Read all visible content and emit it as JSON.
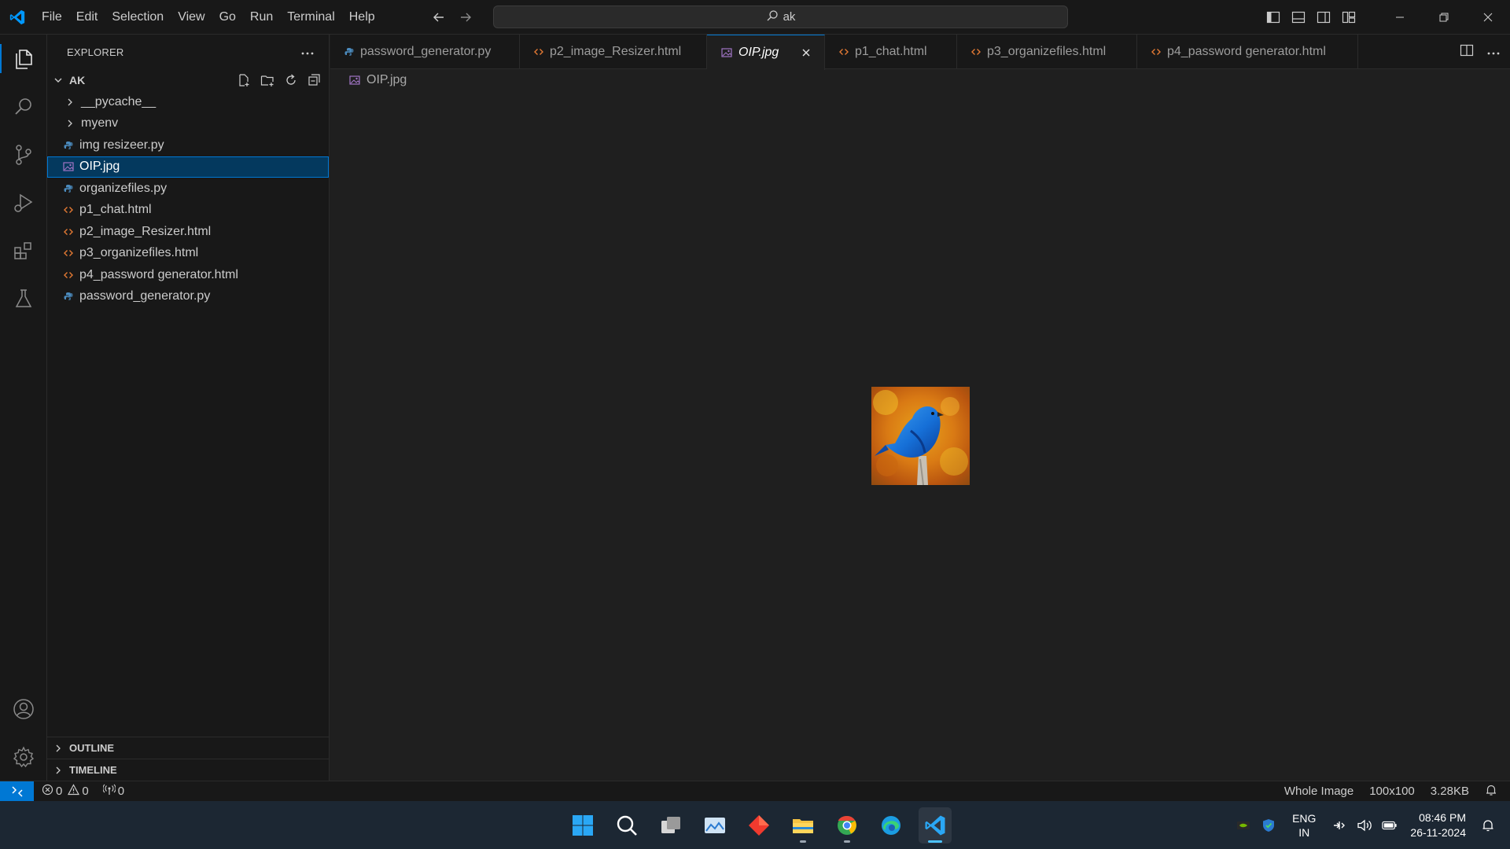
{
  "menu": [
    "File",
    "Edit",
    "Selection",
    "View",
    "Go",
    "Run",
    "Terminal",
    "Help"
  ],
  "search": {
    "text": "ak"
  },
  "sidebar": {
    "title": "EXPLORER",
    "folder": "AK",
    "items": [
      {
        "label": "__pycache__",
        "kind": "folder"
      },
      {
        "label": "myenv",
        "kind": "folder"
      },
      {
        "label": "img resizeer.py",
        "kind": "python"
      },
      {
        "label": "OIP.jpg",
        "kind": "image",
        "selected": true
      },
      {
        "label": "organizefiles.py",
        "kind": "python"
      },
      {
        "label": "p1_chat.html",
        "kind": "html"
      },
      {
        "label": "p2_image_Resizer.html",
        "kind": "html"
      },
      {
        "label": "p3_organizefiles.html",
        "kind": "html"
      },
      {
        "label": "p4_password generator.html",
        "kind": "html"
      },
      {
        "label": "password_generator.py",
        "kind": "python"
      }
    ],
    "outline": "OUTLINE",
    "timeline": "TIMELINE"
  },
  "tabs": [
    {
      "label": "password_generator.py",
      "kind": "python"
    },
    {
      "label": "p2_image_Resizer.html",
      "kind": "html"
    },
    {
      "label": "OIP.jpg",
      "kind": "image",
      "active": true
    },
    {
      "label": "p1_chat.html",
      "kind": "html"
    },
    {
      "label": "p3_organizefiles.html",
      "kind": "html"
    },
    {
      "label": "p4_password generator.html",
      "kind": "html"
    }
  ],
  "breadcrumb": "OIP.jpg",
  "status": {
    "errors": "0",
    "warnings": "0",
    "ports": "0",
    "zoom": "Whole Image",
    "dimensions": "100x100",
    "size": "3.28KB"
  },
  "taskbar": {
    "lang_top": "ENG",
    "lang_bottom": "IN",
    "time": "08:46 PM",
    "date": "26-11-2024"
  },
  "colors": {
    "accent": "#0078d4",
    "python_icon": "#4b8bbe",
    "html_icon": "#e37933",
    "image_icon": "#a074c4"
  }
}
